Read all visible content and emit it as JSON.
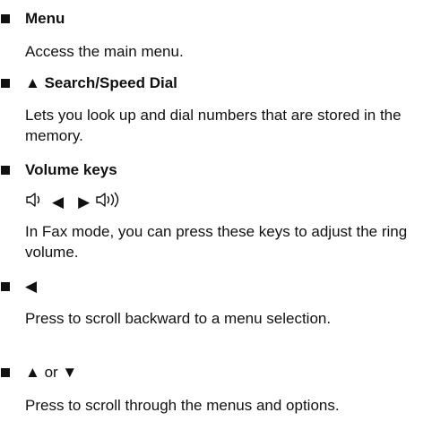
{
  "items": [
    {
      "head": "Menu",
      "desc": "Access the main menu."
    },
    {
      "head_prefix": "▲",
      "head": "Search/Speed Dial",
      "desc": "Lets you look up and dial numbers that are stored in the memory."
    },
    {
      "head": "Volume keys",
      "keys": {
        "left": "◀",
        "right": "▶"
      },
      "desc": "In Fax mode, you can press these keys to adjust the ring volume."
    },
    {
      "head": "◀",
      "desc": "Press to scroll backward to a menu selection."
    },
    {
      "head_a": "▲",
      "head_or": "or",
      "head_b": "▼",
      "desc": "Press to scroll through the menus and options."
    }
  ],
  "icons": {
    "volume_down": "speaker-low-icon",
    "volume_up": "speaker-high-icon"
  }
}
